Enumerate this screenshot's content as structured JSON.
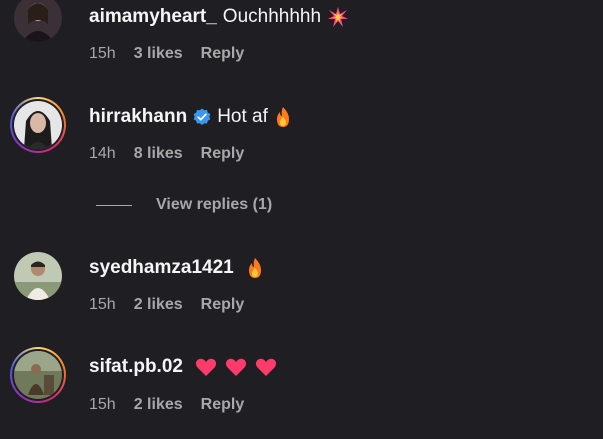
{
  "comments": [
    {
      "username": "aimamyheart_",
      "text": "Ouchhhhhh",
      "emoji": "collision-icon",
      "time": "15h",
      "likes": "3 likes",
      "reply": "Reply",
      "story_ring": false,
      "verified": false
    },
    {
      "username": "hirrakhann",
      "text": "Hot af",
      "emoji": "fire-icon",
      "time": "14h",
      "likes": "8 likes",
      "reply": "Reply",
      "story_ring": true,
      "verified": true,
      "view_replies": "View replies (1)"
    },
    {
      "username": "syedhamza1421",
      "text": "",
      "emoji": "fire-icon",
      "time": "15h",
      "likes": "2 likes",
      "reply": "Reply",
      "story_ring": false,
      "verified": false
    },
    {
      "username": "sifat.pb.02",
      "text": "",
      "emoji": "heart-icon x3",
      "time": "15h",
      "likes": "2 likes",
      "reply": "Reply",
      "story_ring": true,
      "verified": false
    }
  ],
  "colors": {
    "background": "#1f1f23",
    "primary_text": "#f5f5f5",
    "secondary_text": "#a8a8a8",
    "verified_blue": "#3897f0",
    "heart_pink": "#ff3b6b",
    "fire_orange": "#ff7a1a"
  }
}
